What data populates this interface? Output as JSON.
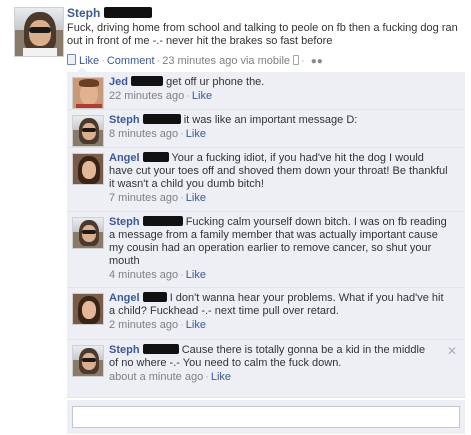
{
  "post": {
    "author": "Steph",
    "text": "Fuck, driving home from school and talking to peole on fb then a fucking dog ran out in front of me -.- never hit the brakes so fast before",
    "like_label": "Like",
    "comment_label": "Comment",
    "time": "23 minutes ago via mobile",
    "icons": {
      "like": "thumbs-up-icon",
      "mobile": "mobile-phone-icon",
      "audience": "friends-icon"
    }
  },
  "comments": [
    {
      "author": "Jed",
      "text": "get off ur phone the.",
      "time": "22 minutes ago",
      "like_label": "Like"
    },
    {
      "author": "Steph",
      "text": "it was like an important message D:",
      "time": "8 minutes ago",
      "like_label": "Like"
    },
    {
      "author": "Angel",
      "text": "Your a fucking idiot, if you had've hit the dog I would have cut your toes off and shoved them down your throat! Be thankful it wasn't a child you dumb bitch!",
      "time": "7 minutes ago",
      "like_label": "Like"
    },
    {
      "author": "Steph",
      "text": "Fucking calm yourself down bitch. I was on fb reading a message from a family member that was actually important cause my cousin had an operation earlier to remove cancer, so shut your mouth",
      "time": "4 minutes ago",
      "like_label": "Like"
    },
    {
      "author": "Angel",
      "text": "I don't wanna hear your problems. What if you had've hit a child? Fuckhead -.- next time pull over retard.",
      "time": "2 minutes ago",
      "like_label": "Like"
    },
    {
      "author": "Steph",
      "text": "Cause there is totally gonna be a kid in the middle of no where -.- You need to calm the fuck down.",
      "time": "about a minute ago",
      "like_label": "Like"
    }
  ],
  "write_comment": {
    "value": "",
    "placeholder": ""
  },
  "colors": {
    "link": "#3b5998",
    "comment_bg": "#edeff4",
    "meta": "#808080"
  }
}
